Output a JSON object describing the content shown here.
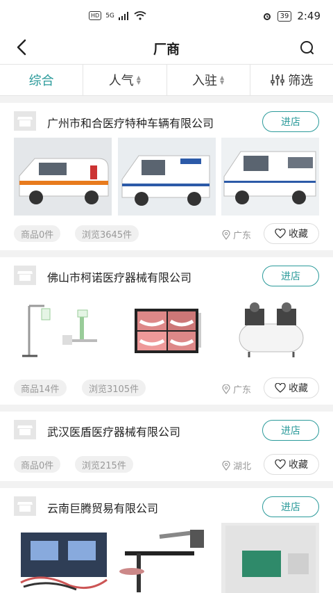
{
  "status": {
    "network": "HD",
    "signal": "5G",
    "battery": "39",
    "time": "2:49"
  },
  "nav": {
    "title": "厂商",
    "back_icon": "back-chevron-icon",
    "search_icon": "search-icon"
  },
  "filters": [
    {
      "label": "综合",
      "active": true
    },
    {
      "label": "人气",
      "sortable": true
    },
    {
      "label": "入驻",
      "sortable": true
    },
    {
      "label": "筛选",
      "icon": "filter-sliders-icon"
    }
  ],
  "companies": [
    {
      "name": "广州市和合医疗特种车辆有限公司",
      "enter_label": "进店",
      "goods": "商品0件",
      "views": "浏览3645件",
      "location": "广东",
      "fav_label": "收藏"
    },
    {
      "name": "佛山市柯诺医疗器械有限公司",
      "enter_label": "进店",
      "goods": "商品14件",
      "views": "浏览3105件",
      "location": "广东",
      "fav_label": "收藏"
    },
    {
      "name": "武汉医盾医疗器械有限公司",
      "enter_label": "进店",
      "goods": "商品0件",
      "views": "浏览215件",
      "location": "湖北",
      "fav_label": "收藏"
    },
    {
      "name": "云南巨腾贸易有限公司",
      "enter_label": "进店"
    }
  ],
  "colors": {
    "accent": "#2a9a9a",
    "background": "#f2f2f2",
    "tag_bg": "#f0f0f0"
  }
}
